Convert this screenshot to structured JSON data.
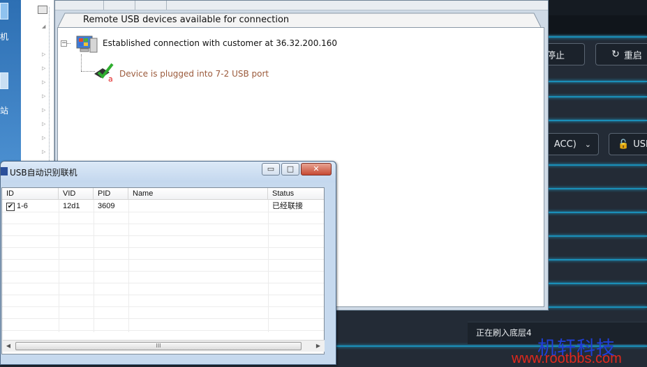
{
  "desktop": {
    "label_1": "机",
    "label_2": "站"
  },
  "server_window": {
    "tab_label": "Remote USB devices available for connection",
    "connection_node": "Established connection with customer at 36.32.200.160",
    "device_node": "Device is plugged into 7-2 USB port",
    "device_node_color": "#9b5a3b"
  },
  "dialog": {
    "title": "USB自动识别联机",
    "min_symbol": "▭",
    "max_symbol": "□",
    "close_symbol": "✕",
    "columns": [
      "ID",
      "VID",
      "PID",
      "Name",
      "Status"
    ],
    "rows": [
      {
        "id": "1-6",
        "checked": "✔",
        "vid": "12d1",
        "pid": "3609",
        "name": "",
        "status": "已经联接"
      }
    ],
    "scroll_left": "◀",
    "scroll_right": "▶",
    "scroll_grip": "III"
  },
  "dark_app": {
    "stop_label": "停止",
    "restart_label": "重启",
    "mode_label": "ACC)",
    "usb_label": "USB",
    "status_text": "正在刷入底层4",
    "accent": "#1fb4e8"
  },
  "watermark": {
    "cn": "机轩科技",
    "url": "www.rootbbs.com"
  }
}
